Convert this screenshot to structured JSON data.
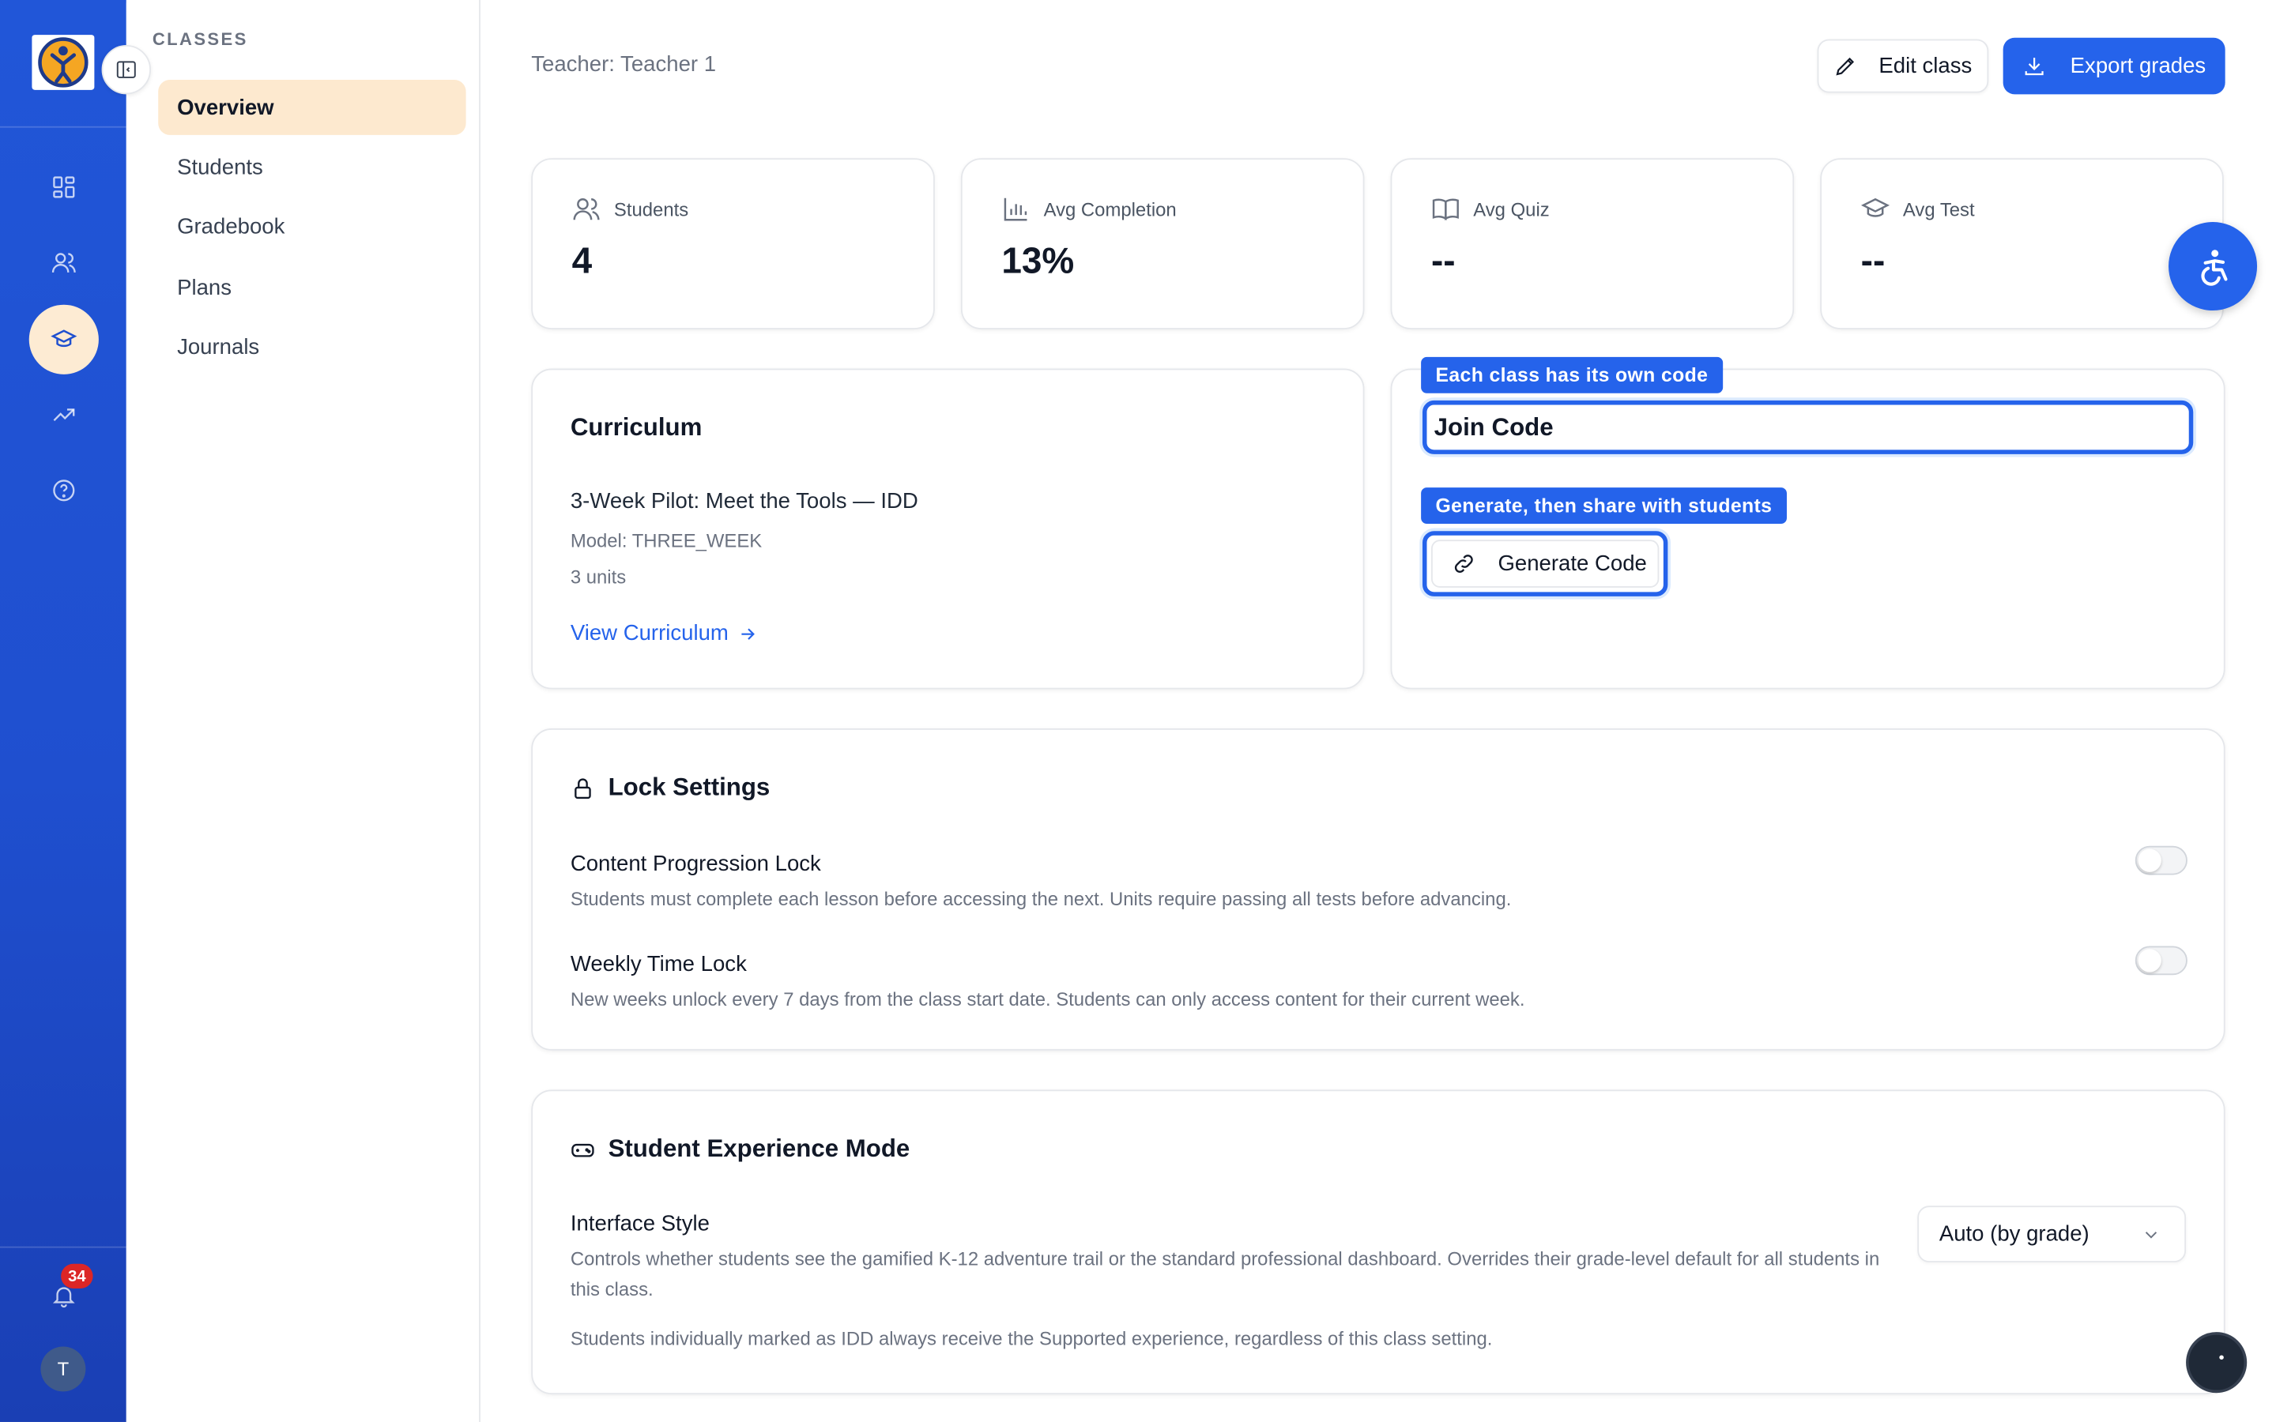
{
  "nav": {
    "section": "CLASSES",
    "items": [
      {
        "label": "Overview",
        "active": true
      },
      {
        "label": "Students"
      },
      {
        "label": "Gradebook"
      },
      {
        "label": "Plans"
      },
      {
        "label": "Journals"
      }
    ],
    "notification_count": "34",
    "avatar_initial": "T"
  },
  "header": {
    "teacher": "Teacher: Teacher 1",
    "edit_label": "Edit class",
    "export_label": "Export grades"
  },
  "stats": [
    {
      "label": "Students",
      "value": "4",
      "icon": "users-icon"
    },
    {
      "label": "Avg Completion",
      "value": "13%",
      "icon": "bar-chart-icon"
    },
    {
      "label": "Avg Quiz",
      "value": "--",
      "icon": "book-open-icon"
    },
    {
      "label": "Avg Test",
      "value": "--",
      "icon": "graduation-cap-icon"
    }
  ],
  "curriculum": {
    "title": "Curriculum",
    "name": "3-Week Pilot: Meet the Tools — IDD",
    "model": "Model: THREE_WEEK",
    "units": "3 units",
    "link": "View Curriculum"
  },
  "join": {
    "tip1": "Each class has its own code",
    "field_label": "Join Code",
    "tip2": "Generate, then share with students",
    "generate_label": "Generate Code"
  },
  "locks": {
    "title": "Lock Settings",
    "items": [
      {
        "name": "Content Progression Lock",
        "desc": "Students must complete each lesson before accessing the next. Units require passing all tests before advancing.",
        "enabled": false
      },
      {
        "name": "Weekly Time Lock",
        "desc": "New weeks unlock every 7 days from the class start date. Students can only access content for their current week.",
        "enabled": false
      }
    ]
  },
  "experience": {
    "title": "Student Experience Mode",
    "setting_name": "Interface Style",
    "desc": "Controls whether students see the gamified K-12 adventure trail or the standard professional dashboard. Overrides their grade-level default for all students in this class.",
    "note": "Students individually marked as IDD always receive the Supported experience, regardless of this class setting.",
    "selected": "Auto (by grade)"
  },
  "colors": {
    "primary": "#2563eb",
    "rail": "#1f4fcf",
    "active_bg": "#fde9cf",
    "badge": "#dc2626"
  }
}
